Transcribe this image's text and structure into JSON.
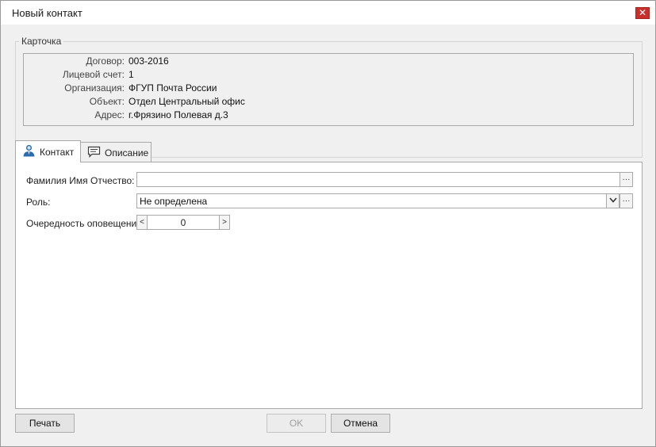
{
  "window": {
    "title": "Новый контакт",
    "close_glyph": "✕"
  },
  "card": {
    "legend": "Карточка",
    "rows": [
      {
        "label": "Договор:",
        "value": "003-2016"
      },
      {
        "label": "Лицевой счет:",
        "value": "1"
      },
      {
        "label": "Организация:",
        "value": "ФГУП Почта России"
      },
      {
        "label": "Объект:",
        "value": "Отдел Центральный офис"
      },
      {
        "label": "Адрес:",
        "value": "г.Фрязино Полевая д.3"
      }
    ]
  },
  "tabs": [
    {
      "label": "Контакт",
      "icon": "person-icon",
      "active": true
    },
    {
      "label": "Описание",
      "icon": "speech-bubble-icon",
      "active": false
    }
  ],
  "form": {
    "fio_label": "Фамилия Имя Отчество:",
    "fio_value": "",
    "role_label": "Роль:",
    "role_value": "Не определена",
    "order_label": "Очередность оповещения:",
    "order_value": "0",
    "ellipsis": "···",
    "chevron": "⌄",
    "decrement": "<",
    "increment": ">"
  },
  "buttons": {
    "print": "Печать",
    "ok": "OK",
    "cancel": "Отмена"
  },
  "colors": {
    "close_button": "#c9302c",
    "panel_bg": "#ffffff",
    "dialog_bg": "#f0f0f0"
  }
}
